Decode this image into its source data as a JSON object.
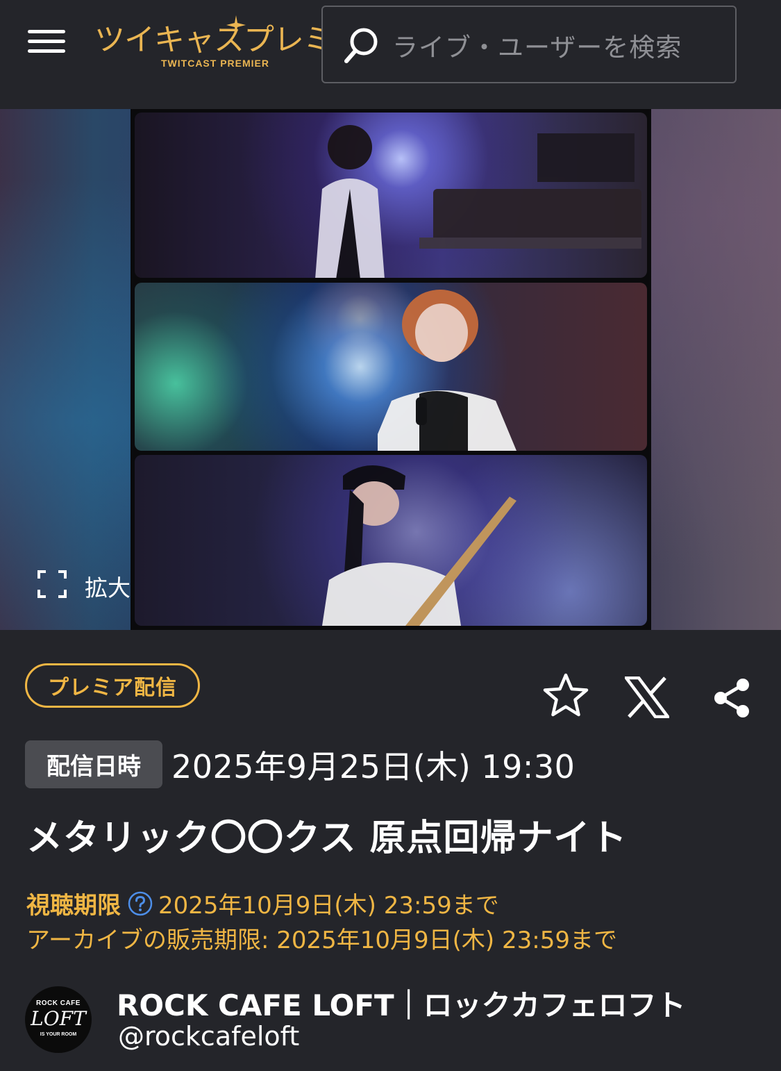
{
  "header": {
    "logo_text": "ツイキャスプレミア",
    "logo_sub": "TWITCAST PREMIER",
    "search_placeholder": "ライブ・ユーザーを検索",
    "brand_color": "#eab552"
  },
  "media": {
    "expand_label": "拡大"
  },
  "event": {
    "premier_badge": "プレミア配信",
    "date_label": "配信日時",
    "date_value": "2025年9月25日(木) 19:30",
    "title": "メタリック〇〇クス 原点回帰ナイト",
    "watch_limit_label": "視聴期限",
    "watch_limit_value": "2025年10月9日(木) 23:59まで",
    "archive_limit": "アーカイブの販売期限: 2025年10月9日(木) 23:59まで",
    "accent_color": "#f0b644"
  },
  "actions": {
    "favorite_icon": "star-icon",
    "x_icon": "x-logo-icon",
    "share_icon": "share-icon"
  },
  "channel": {
    "avatar_top": "ROCK CAFE",
    "avatar_mid": "LOFT",
    "avatar_bottom": "IS YOUR ROOM",
    "name": "ROCK CAFE LOFT｜ロックカフェロフト",
    "handle": "@rockcafeloft"
  }
}
